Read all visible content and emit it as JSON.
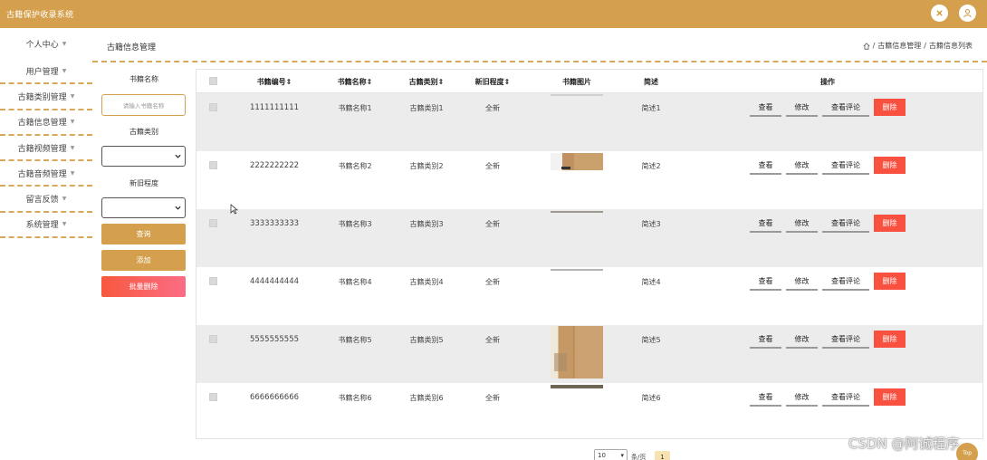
{
  "app": {
    "title": "古籍保护收录系统"
  },
  "sidebar": {
    "items": [
      {
        "label": "个人中心"
      },
      {
        "label": "用户管理"
      },
      {
        "label": "古籍类别管理"
      },
      {
        "label": "古籍信息管理"
      },
      {
        "label": "古籍视频管理"
      },
      {
        "label": "古籍音频管理"
      },
      {
        "label": "留言反馈"
      },
      {
        "label": "系统管理"
      }
    ]
  },
  "page": {
    "title": "古籍信息管理",
    "breadcrumb": [
      "古籍信息管理",
      "古籍信息列表"
    ]
  },
  "filter": {
    "name_label": "书籍名称",
    "name_placeholder": "请输入书籍名称",
    "category_label": "古籍类别",
    "condition_label": "新旧程度",
    "search_button": "查询",
    "add_button": "添加",
    "batch_delete_button": "批量删除"
  },
  "table": {
    "headers": [
      "书籍编号",
      "书籍名称",
      "古籍类别",
      "新旧程度",
      "书籍图片",
      "简述",
      "操作"
    ],
    "rows": [
      {
        "code": "1111111111",
        "name": "书籍名称1",
        "category": "古籍类别1",
        "condition": "全新",
        "summary": "简述1"
      },
      {
        "code": "2222222222",
        "name": "书籍名称2",
        "category": "古籍类别2",
        "condition": "全新",
        "summary": "简述2"
      },
      {
        "code": "3333333333",
        "name": "书籍名称3",
        "category": "古籍类别3",
        "condition": "全新",
        "summary": "简述3"
      },
      {
        "code": "4444444444",
        "name": "书籍名称4",
        "category": "古籍类别4",
        "condition": "全新",
        "summary": "简述4"
      },
      {
        "code": "5555555555",
        "name": "书籍名称5",
        "category": "古籍类别5",
        "condition": "全新",
        "summary": "简述5"
      },
      {
        "code": "6666666666",
        "name": "书籍名称6",
        "category": "古籍类别6",
        "condition": "全新",
        "summary": "简述6"
      }
    ],
    "actions": {
      "view": "查看",
      "edit": "修改",
      "view_comments": "查看评论",
      "delete": "删除"
    }
  },
  "pagination": {
    "page_size": "10",
    "per_page_label": "条/页",
    "current_page": "1"
  },
  "watermark": "CSDN @阿诚程序",
  "back_to_top": "Top",
  "colors": {
    "accent": "#d4a04d",
    "danger": "#f9513f",
    "row_stripe": "#ececec"
  }
}
